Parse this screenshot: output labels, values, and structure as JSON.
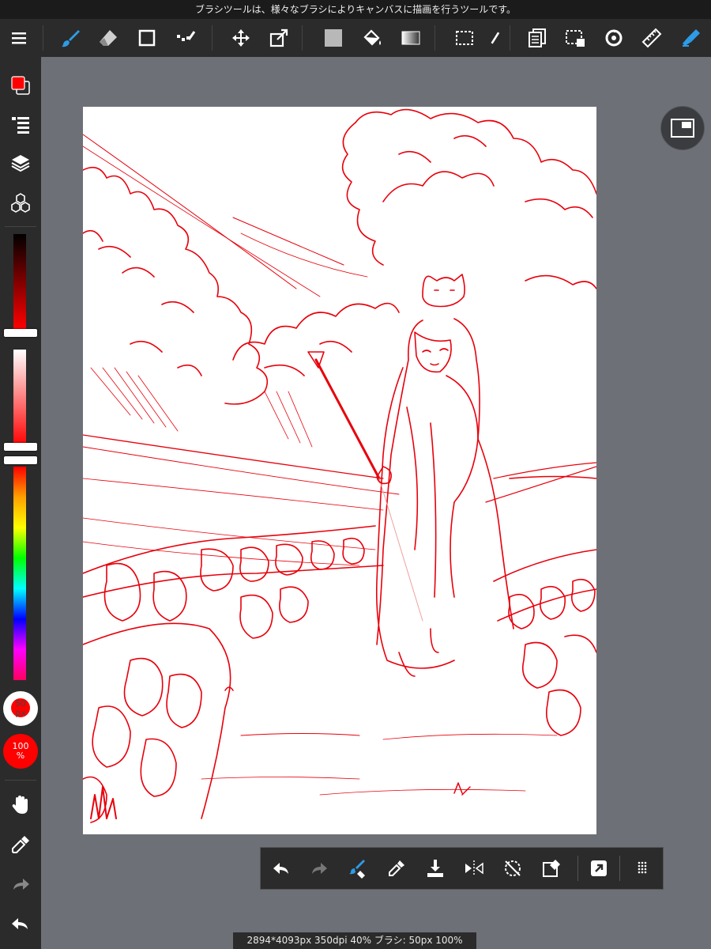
{
  "tooltip": "ブラシツールは、様々なブラシによりキャンバスに描画を行うツールです。",
  "toolbar": {
    "items": [
      "menu-icon",
      "brush-icon",
      "eraser-icon",
      "shape-icon",
      "dot-line-icon",
      "move-icon",
      "transform-icon",
      "fill-color-icon",
      "bucket-icon",
      "gradient-icon",
      "select-icon",
      "magic-wand-icon",
      "copy-layer-icon",
      "deselect-icon",
      "snap-icon",
      "ruler-icon",
      "pen-icon"
    ]
  },
  "sidebar": {
    "brush_size": {
      "value": "50",
      "unit": "px"
    },
    "opacity": {
      "value": "100",
      "unit": "%"
    },
    "colors": {
      "primary": "#ff0000",
      "secondary": "#2b2b2b"
    }
  },
  "quickbar": {
    "items": [
      "undo-icon",
      "redo-icon",
      "brush-swap-icon",
      "eyedropper-icon",
      "save-icon",
      "flip-icon",
      "rotate-reset-icon",
      "clear-icon",
      "share-icon",
      "grid-dots-icon"
    ]
  },
  "status": "2894*4093px 350dpi 40% ブラシ: 50px 100%",
  "colors": {
    "accent": "#1e88e5",
    "toolbar_bg": "#2b2b2b",
    "workspace_bg": "#6d7076",
    "ink": "#e8000b"
  }
}
